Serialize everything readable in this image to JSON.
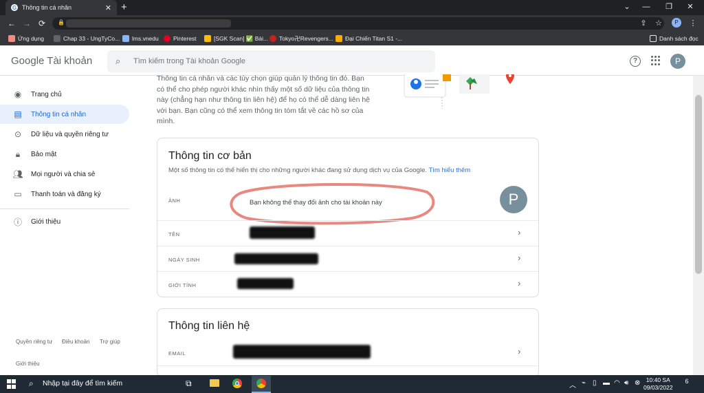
{
  "browser": {
    "tab_title": "Thông tin cá nhân",
    "tab_close": "✕",
    "new_tab": "+",
    "window_controls": [
      "⌄",
      "—",
      "❐",
      "✕"
    ],
    "bookmarks": [
      {
        "label": "Ứng dụng",
        "icon": "apps-grid-icon",
        "color": "#f28b82"
      },
      {
        "label": "Chap 33 - UngTyCo...",
        "icon": "site-icon",
        "color": "#5f6368"
      },
      {
        "label": "lms.vnedu",
        "icon": "site-icon",
        "color": "#8ab4f8"
      },
      {
        "label": "Pinterest",
        "icon": "pinterest-icon",
        "color": "#e60023"
      },
      {
        "label": "[SGK Scan] ✅ Bài...",
        "icon": "site-icon",
        "color": "#fbbc04"
      },
      {
        "label": "Tokyo卍Revengers...",
        "icon": "site-icon",
        "color": "#c5221f"
      },
      {
        "label": "Đại Chiến Titan S1 -...",
        "icon": "site-icon",
        "color": "#f9ab00"
      },
      {
        "label": "Danh sách đọc",
        "icon": "reading-list-icon",
        "color": "#e8eaed"
      }
    ],
    "profile_initial": "P"
  },
  "header": {
    "logo_google": "Google",
    "logo_product": "Tài khoản",
    "search_placeholder": "Tìm kiếm trong Tài khoản Google",
    "avatar_initial": "P"
  },
  "sidebar": {
    "items": [
      {
        "label": "Trang chủ",
        "icon": "account-circle-icon"
      },
      {
        "label": "Thông tin cá nhân",
        "icon": "id-card-icon",
        "active": true
      },
      {
        "label": "Dữ liệu và quyền riêng tư",
        "icon": "toggle-icon"
      },
      {
        "label": "Bảo mật",
        "icon": "lock-icon"
      },
      {
        "label": "Mọi người và chia sẻ",
        "icon": "people-icon"
      },
      {
        "label": "Thanh toán và đăng ký",
        "icon": "credit-card-icon"
      }
    ],
    "about": {
      "label": "Giới thiệu",
      "icon": "info-icon"
    },
    "footer": [
      "Quyền riêng tư",
      "Điều khoản",
      "Trợ giúp",
      "Giới thiệu"
    ]
  },
  "main": {
    "intro": "Thông tin cá nhân và các tùy chọn giúp quản lý thông tin đó. Bạn có thể cho phép người khác nhìn thấy một số dữ liệu của thông tin này (chẳng hạn như thông tin liên hệ) để họ có thể dễ dàng liên hệ với bạn. Bạn cũng có thể xem thông tin tóm tắt về các hồ sơ của mình.",
    "basic": {
      "title": "Thông tin cơ bản",
      "description": "Một số thông tin có thể hiển thị cho những người khác đang sử dụng dịch vụ của Google.",
      "learn_more": "Tìm hiểu thêm",
      "photo_label": "ẢNH",
      "photo_message": "Bạn không thể thay đổi ảnh cho tài khoản này",
      "photo_initial": "P",
      "rows": [
        "TÊN",
        "NGÀY SINH",
        "GIỚI TÍNH"
      ]
    },
    "contact": {
      "title": "Thông tin liên hệ",
      "rows": [
        "EMAIL"
      ]
    }
  },
  "taskbar": {
    "search_text": "Nhập tại đây để tìm kiếm",
    "time": "10:40 SA",
    "date": "09/03/2022",
    "notification_count": "6"
  },
  "colors": {
    "accent": "#1a73e8",
    "active_nav_bg": "#e8f0fe",
    "avatar": "#78909c",
    "highlight_circle": "#e57368"
  }
}
